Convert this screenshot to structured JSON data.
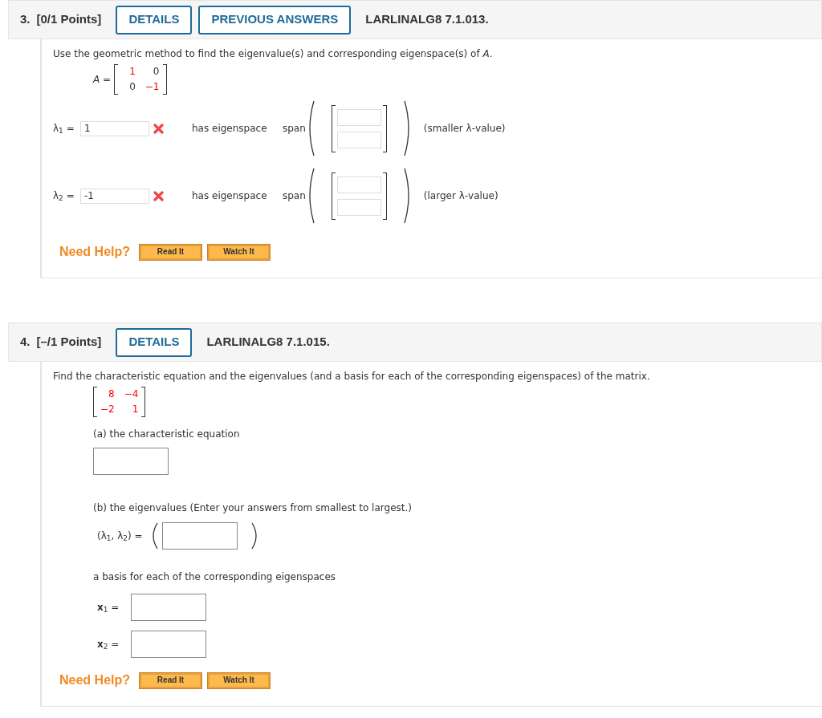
{
  "problems": [
    {
      "number": "3.",
      "points": "[0/1 Points]",
      "buttons": [
        {
          "label": "DETAILS"
        },
        {
          "label": "PREVIOUS ANSWERS"
        }
      ],
      "code": "LARLINALG8 7.1.013.",
      "prompt": "Use the geometric method to find the eigenvalue(s) and corresponding eigenspace(s) of *A*.",
      "parts": [
        {
          "kind": "matrix",
          "label": "*A* =",
          "cells": [
            [
              {
                "text": "1",
                "color": "#ff0000"
              },
              {
                "text": "0",
                "color": "#333333"
              }
            ],
            [
              {
                "text": "0",
                "color": "#333333"
              },
              {
                "text": "−1",
                "color": "#ff0000"
              }
            ]
          ]
        },
        {
          "kind": "eigen",
          "label": "λ$_{1}$ =",
          "value": "1",
          "correct": false,
          "text": "has eigenspace",
          "span": "span",
          "note": "(smaller λ-value)"
        },
        {
          "kind": "eigen",
          "label": "λ$_{2}$ =",
          "value": "-1",
          "correct": false,
          "text": "has eigenspace",
          "span": "span",
          "note": "(larger λ-value)"
        }
      ],
      "help": {
        "label": "Need Help?",
        "buttons": [
          "Read It",
          "Watch It"
        ]
      }
    },
    {
      "number": "4.",
      "points": "[–/1 Points]",
      "buttons": [
        {
          "label": "DETAILS"
        }
      ],
      "code": "LARLINALG8 7.1.015.",
      "prompt": "Find the characteristic equation and the eigenvalues (and a basis for each of the corresponding eigenspaces) of the matrix.",
      "parts": [
        {
          "kind": "matrix",
          "cells": [
            [
              {
                "text": "8",
                "color": "#ff0000"
              },
              {
                "text": "−4",
                "color": "#ff0000"
              }
            ],
            [
              {
                "text": "−2",
                "color": "#ff0000"
              },
              {
                "text": "1",
                "color": "#ff0000"
              }
            ]
          ]
        },
        {
          "kind": "heading",
          "text": "(a) the characteristic equation"
        },
        {
          "kind": "field"
        },
        {
          "kind": "heading",
          "text": "(b) the eigenvalues (Enter your answers from smallest to largest.)"
        },
        {
          "kind": "tuple",
          "label": "(λ$_{1}$, λ$_{2}$) ="
        },
        {
          "kind": "heading",
          "text": "a basis for each of the corresponding eigenspaces"
        },
        {
          "kind": "labeled_field",
          "label": "**x**$_{1}$ ="
        },
        {
          "kind": "labeled_field",
          "label": "**x**$_{2}$ ="
        }
      ],
      "help": {
        "label": "Need Help?",
        "buttons": [
          "Read It",
          "Watch It"
        ]
      }
    }
  ]
}
